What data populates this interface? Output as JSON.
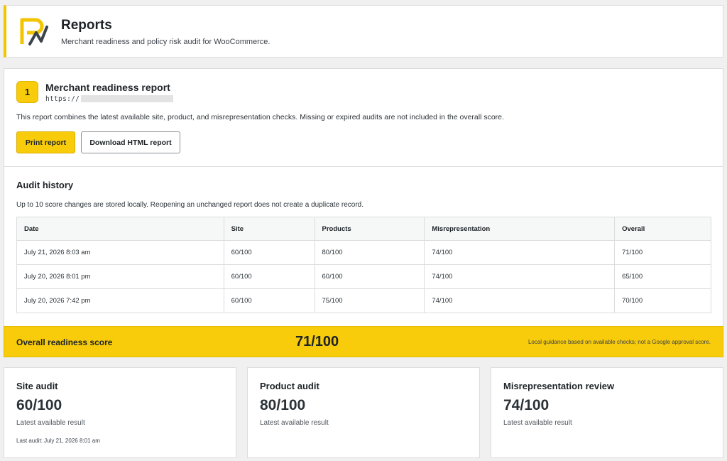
{
  "header": {
    "title": "Reports",
    "subtitle": "Merchant readiness and policy risk audit for WooCommerce."
  },
  "report": {
    "step": "1",
    "title": "Merchant readiness report",
    "url": "https://",
    "description": "This report combines the latest available site, product, and misrepresentation checks. Missing or expired audits are not included in the overall score.",
    "print_label": "Print report",
    "download_label": "Download HTML report"
  },
  "history": {
    "title": "Audit history",
    "description": "Up to 10 score changes are stored locally. Reopening an unchanged report does not create a duplicate record.",
    "columns": [
      "Date",
      "Site",
      "Products",
      "Misrepresentation",
      "Overall"
    ],
    "rows": [
      [
        "July 21, 2026 8:03 am",
        "60/100",
        "80/100",
        "74/100",
        "71/100"
      ],
      [
        "July 20, 2026 8:01 pm",
        "60/100",
        "60/100",
        "74/100",
        "65/100"
      ],
      [
        "July 20, 2026 7:42 pm",
        "60/100",
        "75/100",
        "74/100",
        "70/100"
      ]
    ]
  },
  "overall": {
    "label": "Overall readiness score",
    "value": "71/100",
    "note": "Local guidance based on available checks; not a Google approval score."
  },
  "audits": {
    "site": {
      "title": "Site audit",
      "score": "60/100",
      "subtitle": "Latest available result",
      "last": "Last audit: July 21, 2026 8:01 am"
    },
    "product": {
      "title": "Product audit",
      "score": "80/100",
      "subtitle": "Latest available result"
    },
    "misrep": {
      "title": "Misrepresentation review",
      "score": "74/100",
      "subtitle": "Latest available result"
    }
  },
  "colors": {
    "accent": "#f8cb0b",
    "background": "#f0f0f1"
  }
}
